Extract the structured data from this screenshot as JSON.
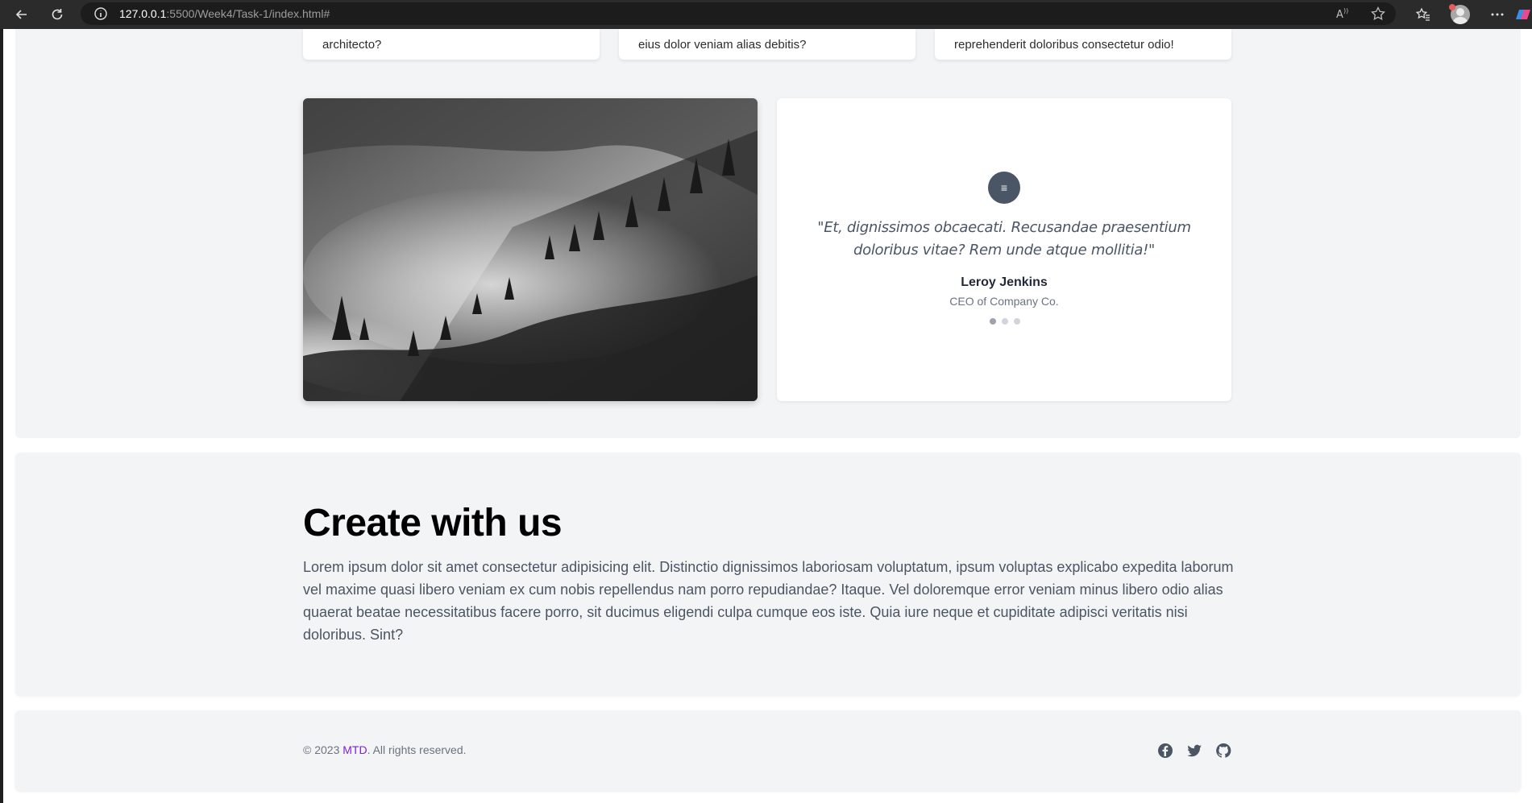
{
  "browser": {
    "url_host": "127.0.0.1",
    "url_rest": ":5500/Week4/Task-1/index.html#"
  },
  "cards_top": [
    {
      "text": "architecto?"
    },
    {
      "text": "eius dolor veniam alias debitis?"
    },
    {
      "text": "reprehenderit doloribus consectetur odio!"
    }
  ],
  "testimonial": {
    "quote_icon": "≡",
    "quote": "\"Et, dignissimos obcaecati. Recusandae praesentium doloribus vitae? Rem unde atque mollitia!\"",
    "name": "Leroy Jenkins",
    "role": "CEO of Company Co."
  },
  "create": {
    "title": "Create with us",
    "text": "Lorem ipsum dolor sit amet consectetur adipisicing elit. Distinctio dignissimos laboriosam voluptatum, ipsum voluptas explicabo expedita laborum vel maxime quasi libero veniam ex cum nobis repellendus nam porro repudiandae? Itaque. Vel doloremque error veniam minus libero odio alias quaerat beatae necessitatibus facere porro, sit ducimus eligendi culpa cumque eos iste. Quia iure neque et cupiditate adipisci veritatis nisi doloribus. Sint?"
  },
  "footer": {
    "copy_prefix": "© 2023 ",
    "brand": "MTD",
    "copy_suffix": ". All rights reserved.",
    "socials": [
      "facebook-icon",
      "twitter-icon",
      "github-icon"
    ]
  },
  "colors": {
    "brand": "#7e22ce",
    "section_bg": "#f3f4f6",
    "quote_icon_bg": "#4a5565"
  }
}
